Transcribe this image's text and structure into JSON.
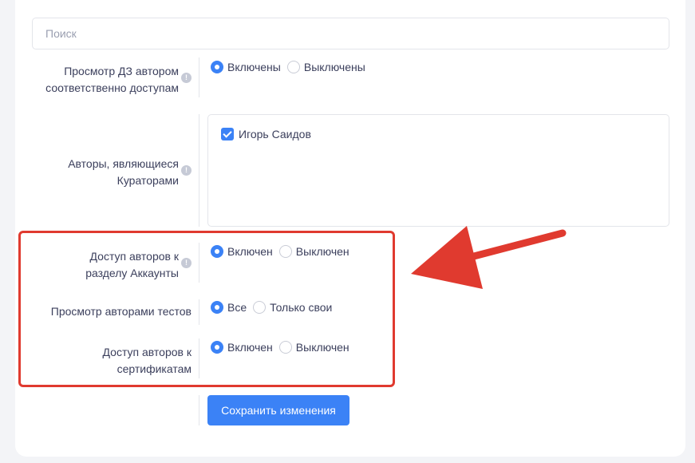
{
  "search": {
    "placeholder": "Поиск"
  },
  "rows": {
    "hw_view": {
      "label_line1": "Просмотр ДЗ автором",
      "label_line2": "соответственно доступам",
      "options": [
        "Включены",
        "Выключены"
      ],
      "selected": "Включены"
    },
    "curators": {
      "label_line1": "Авторы, являющиеся",
      "label_line2": "Кураторами",
      "authors": [
        {
          "name": "Игорь Саидов",
          "checked": true
        }
      ]
    },
    "accounts_access": {
      "label_line1": "Доступ авторов к",
      "label_line2": "разделу Аккаунты",
      "options": [
        "Включен",
        "Выключен"
      ],
      "selected": "Включен"
    },
    "tests_view": {
      "label": "Просмотр авторами тестов",
      "options": [
        "Все",
        "Только свои"
      ],
      "selected": "Все"
    },
    "certificates_access": {
      "label_line1": "Доступ авторов к",
      "label_line2": "сертификатам",
      "options": [
        "Включен",
        "Выключен"
      ],
      "selected": "Включен"
    }
  },
  "info_icon_glyph": "!",
  "save_button": "Сохранить изменения",
  "colors": {
    "accent": "#3b82f6",
    "highlight": "#e03a2f"
  }
}
